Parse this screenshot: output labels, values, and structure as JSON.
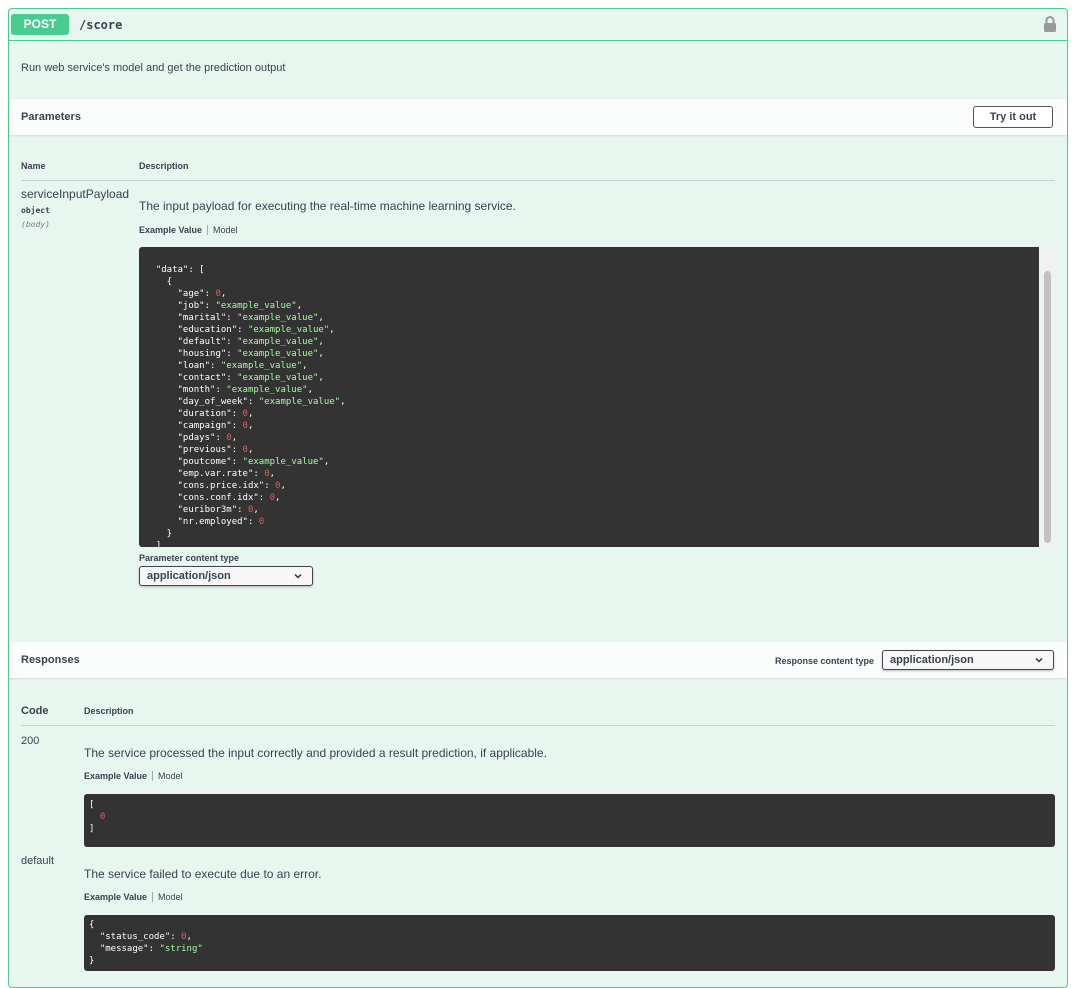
{
  "operation": {
    "method": "POST",
    "path": "/score",
    "summary": "Run web service's model and get the prediction output"
  },
  "parameters": {
    "title": "Parameters",
    "try_button": "Try it out",
    "col_name": "Name",
    "col_description": "Description",
    "param": {
      "name": "serviceInputPayload",
      "type": "object",
      "in": "(body)",
      "description": "The input payload for executing the real-time machine learning service."
    },
    "tab_example": "Example Value",
    "tab_model": "Model",
    "content_type_label": "Parameter content type",
    "content_type_value": "application/json"
  },
  "example_body_lines": [
    [
      [
        "k",
        "  \"data\": ["
      ]
    ],
    [
      [
        "k",
        "    {"
      ]
    ],
    [
      [
        "k",
        "      \"age\": "
      ],
      [
        "n",
        "0"
      ],
      [
        "k",
        ","
      ]
    ],
    [
      [
        "k",
        "      \"job\": "
      ],
      [
        "s",
        "\"example_value\""
      ],
      [
        "k",
        ","
      ]
    ],
    [
      [
        "k",
        "      \"marital\": "
      ],
      [
        "s",
        "\"example_value\""
      ],
      [
        "k",
        ","
      ]
    ],
    [
      [
        "k",
        "      \"education\": "
      ],
      [
        "s",
        "\"example_value\""
      ],
      [
        "k",
        ","
      ]
    ],
    [
      [
        "k",
        "      \"default\": "
      ],
      [
        "s",
        "\"example_value\""
      ],
      [
        "k",
        ","
      ]
    ],
    [
      [
        "k",
        "      \"housing\": "
      ],
      [
        "s",
        "\"example_value\""
      ],
      [
        "k",
        ","
      ]
    ],
    [
      [
        "k",
        "      \"loan\": "
      ],
      [
        "s",
        "\"example_value\""
      ],
      [
        "k",
        ","
      ]
    ],
    [
      [
        "k",
        "      \"contact\": "
      ],
      [
        "s",
        "\"example_value\""
      ],
      [
        "k",
        ","
      ]
    ],
    [
      [
        "k",
        "      \"month\": "
      ],
      [
        "s",
        "\"example_value\""
      ],
      [
        "k",
        ","
      ]
    ],
    [
      [
        "k",
        "      \"day_of_week\": "
      ],
      [
        "s",
        "\"example_value\""
      ],
      [
        "k",
        ","
      ]
    ],
    [
      [
        "k",
        "      \"duration\": "
      ],
      [
        "n",
        "0"
      ],
      [
        "k",
        ","
      ]
    ],
    [
      [
        "k",
        "      \"campaign\": "
      ],
      [
        "n",
        "0"
      ],
      [
        "k",
        ","
      ]
    ],
    [
      [
        "k",
        "      \"pdays\": "
      ],
      [
        "n",
        "0"
      ],
      [
        "k",
        ","
      ]
    ],
    [
      [
        "k",
        "      \"previous\": "
      ],
      [
        "n",
        "0"
      ],
      [
        "k",
        ","
      ]
    ],
    [
      [
        "k",
        "      \"poutcome\": "
      ],
      [
        "s",
        "\"example_value\""
      ],
      [
        "k",
        ","
      ]
    ],
    [
      [
        "k",
        "      \"emp.var.rate\": "
      ],
      [
        "n",
        "0"
      ],
      [
        "k",
        ","
      ]
    ],
    [
      [
        "k",
        "      \"cons.price.idx\": "
      ],
      [
        "n",
        "0"
      ],
      [
        "k",
        ","
      ]
    ],
    [
      [
        "k",
        "      \"cons.conf.idx\": "
      ],
      [
        "n",
        "0"
      ],
      [
        "k",
        ","
      ]
    ],
    [
      [
        "k",
        "      \"euribor3m\": "
      ],
      [
        "n",
        "0"
      ],
      [
        "k",
        ","
      ]
    ],
    [
      [
        "k",
        "      \"nr.employed\": "
      ],
      [
        "n",
        "0"
      ]
    ],
    [
      [
        "k",
        "    }"
      ]
    ],
    [
      [
        "k",
        "  ]"
      ]
    ],
    [
      [
        "k",
        "}"
      ]
    ]
  ],
  "responses": {
    "title": "Responses",
    "content_type_label": "Response content type",
    "content_type_value": "application/json",
    "col_code": "Code",
    "col_description": "Description",
    "tab_example": "Example Value",
    "tab_model": "Model",
    "items": [
      {
        "code": "200",
        "description": "The service processed the input correctly and provided a result prediction, if applicable.",
        "example_lines": [
          [
            [
              "k",
              "["
            ]
          ],
          [
            [
              "k",
              "  "
            ],
            [
              "n",
              "0"
            ]
          ],
          [
            [
              "k",
              "]"
            ]
          ]
        ]
      },
      {
        "code": "default",
        "description": "The service failed to execute due to an error.",
        "example_lines": [
          [
            [
              "k",
              "{"
            ]
          ],
          [
            [
              "k",
              "  \"status_code\": "
            ],
            [
              "n",
              "0"
            ],
            [
              "k",
              ","
            ]
          ],
          [
            [
              "k",
              "  \"message\": "
            ],
            [
              "s",
              "\"string\""
            ]
          ],
          [
            [
              "k",
              "}"
            ]
          ]
        ]
      }
    ]
  },
  "colors": {
    "accent": "#49cc90",
    "block_bg": "#e8f6f0",
    "code_bg": "#333333",
    "string": "#a2fca2",
    "number": "#d36363"
  }
}
